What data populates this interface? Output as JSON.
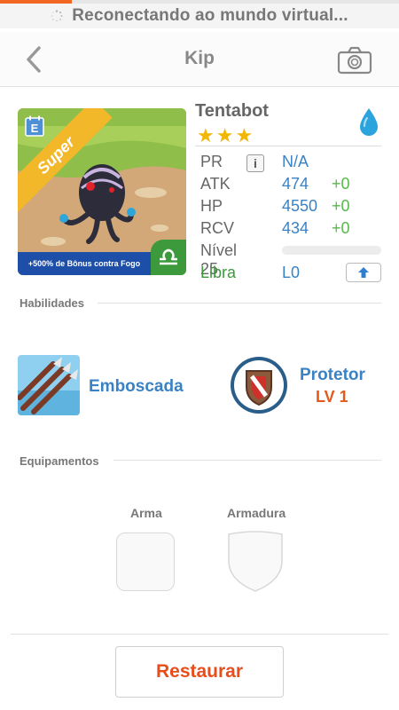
{
  "status": {
    "message": "Reconectando ao mundo virtual...",
    "progress": 0.18,
    "progress_color": "#f26522"
  },
  "navbar": {
    "title": "Kip",
    "back_icon": "chevron-left-icon",
    "camera_icon": "camera-icon"
  },
  "monster": {
    "name": "Tentabot",
    "stars": "★★★",
    "star_count": 3,
    "element_icon": "water-drop-icon",
    "card": {
      "ribbon": "Super",
      "badge": "E",
      "bonus_text": "+500% de Bônus contra Fogo",
      "zodiac_icon": "libra-icon"
    },
    "stats": {
      "pr": {
        "label": "PR",
        "value": "N/A"
      },
      "atk": {
        "label": "ATK",
        "value": "474",
        "bonus": "+0"
      },
      "hp": {
        "label": "HP",
        "value": "4550",
        "bonus": "+0"
      },
      "rcv": {
        "label": "RCV",
        "value": "434",
        "bonus": "+0"
      },
      "level": {
        "label": "Nível 25",
        "progress": 0
      },
      "zodiac": {
        "label": "Libra",
        "value": "L0"
      }
    }
  },
  "skills": {
    "heading": "Habilidades",
    "active": {
      "name": "Emboscada",
      "icon": "arrows-icon"
    },
    "passive": {
      "name": "Protetor",
      "level": "LV 1",
      "icon": "shield-icon"
    }
  },
  "equipment": {
    "heading": "Equipamentos",
    "weapon_label": "Arma",
    "armor_label": "Armadura"
  },
  "actions": {
    "restore_label": "Restaurar"
  },
  "colors": {
    "accent_blue": "#3a82c4",
    "bonus_green": "#57b94a",
    "action_orange": "#e84e1b"
  }
}
